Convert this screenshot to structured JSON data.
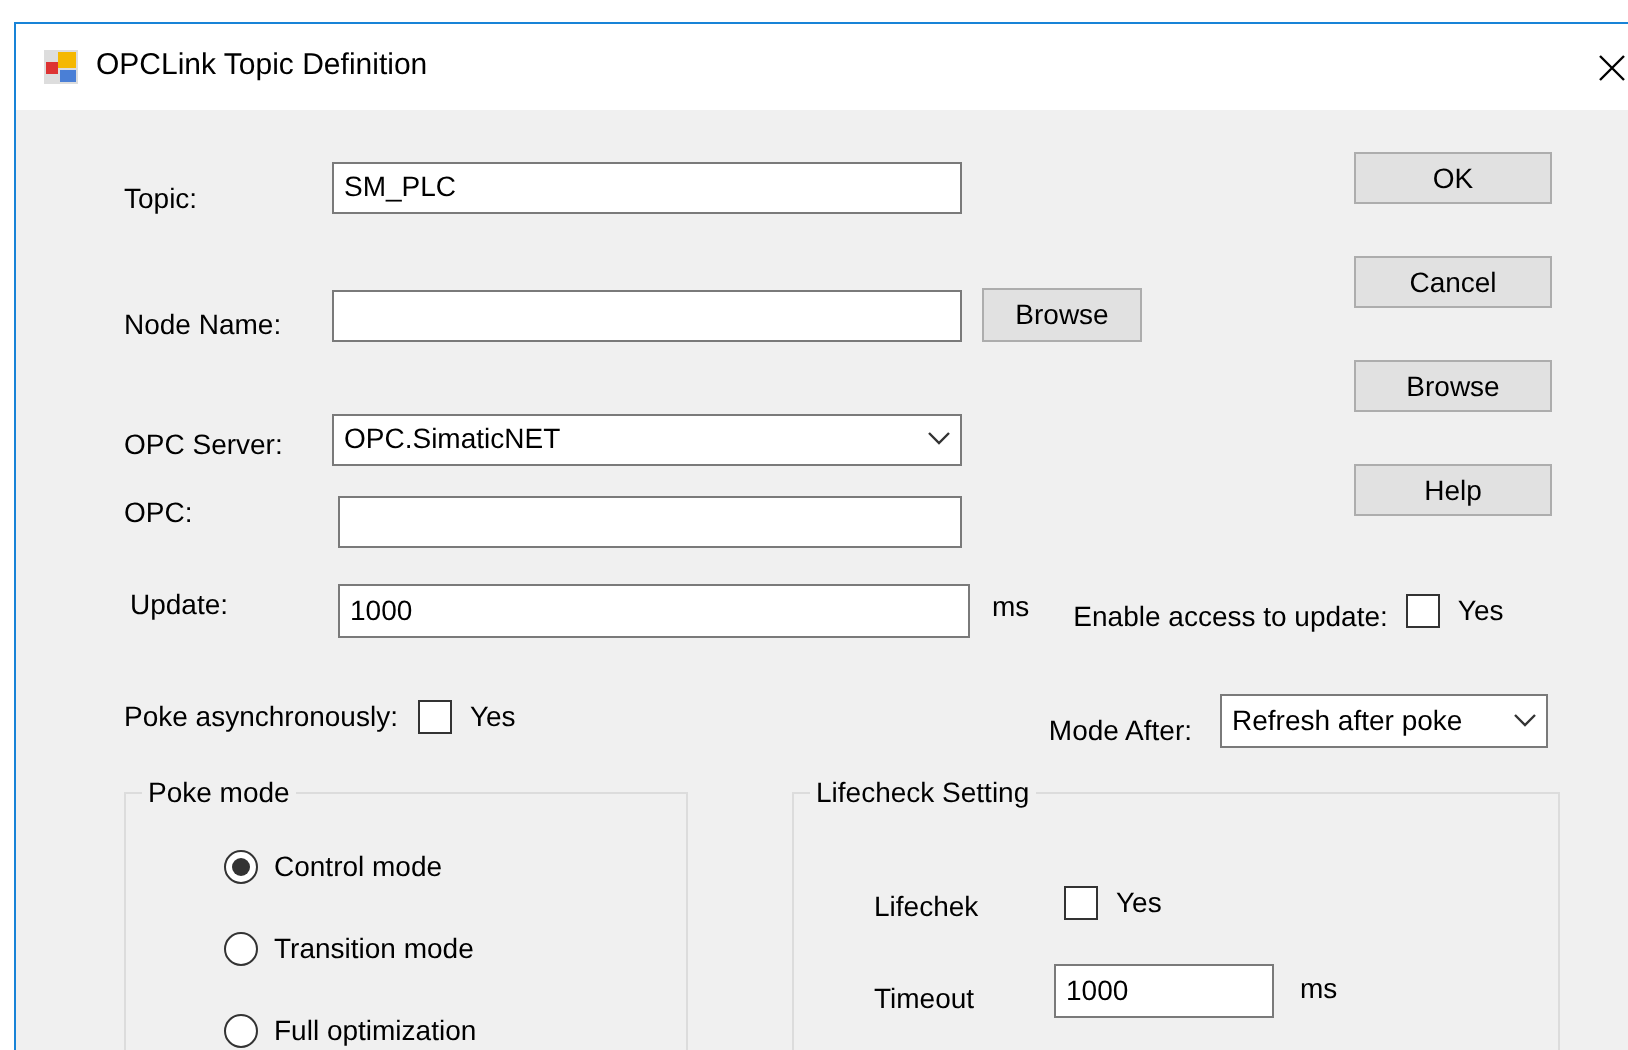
{
  "window": {
    "title": "OPCLink Topic Definition"
  },
  "fields": [
    {
      "kind": "text",
      "label": "Topic:",
      "value": "SM_PLC"
    },
    {
      "kind": "text-browse",
      "label": "Node Name:",
      "button": "Browse"
    },
    {
      "kind": "combo",
      "label": "OPC Server:",
      "value": "OPC.SimaticNET"
    },
    {
      "kind": "text",
      "label": "OPC:"
    }
  ],
  "buttons": [
    "OK",
    "Cancel",
    "Browse",
    "Help"
  ],
  "update": {
    "label": "Update:",
    "value": "1000",
    "unit": "ms"
  },
  "enable_access": {
    "label": "Enable access to update:",
    "option": "Yes",
    "checked": false
  },
  "poke_async": {
    "label": "Poke asynchronously:",
    "option": "Yes",
    "checked": false
  },
  "mode_after": {
    "label": "Mode After:",
    "value": "Refresh after poke"
  },
  "poke_mode": {
    "title": "Poke mode",
    "options": [
      {
        "label": "Control mode",
        "selected": true
      },
      {
        "label": "Transition mode",
        "selected": false
      },
      {
        "label": "Full optimization",
        "selected": false
      }
    ]
  },
  "lifecheck": {
    "title": "Lifecheck Setting",
    "check": {
      "label": "Lifechek",
      "option": "Yes",
      "checked": false
    },
    "timeout": {
      "label": "Timeout",
      "value": "1000",
      "unit": "ms"
    }
  }
}
